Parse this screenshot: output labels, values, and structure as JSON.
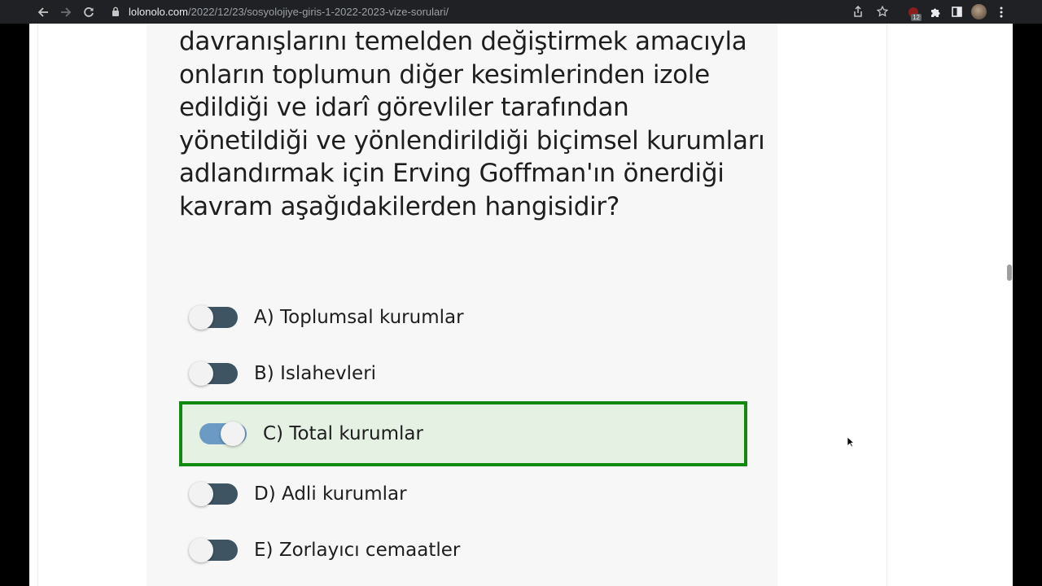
{
  "browser": {
    "url_host": "lolonolo.com",
    "url_path": "/2022/12/23/sosyolojiye-giris-1-2022-2023-vize-sorulari/",
    "extension_badge": "12",
    "icons": [
      "back-icon",
      "forward-icon",
      "reload-icon",
      "lock-icon",
      "share-icon",
      "bookmark-star-icon",
      "extension-icon",
      "puzzle-icon",
      "sidebar-icon",
      "avatar",
      "menu-icon"
    ]
  },
  "question": {
    "text": "davranışlarını temelden değiştirmek amacıyla onların toplumun diğer kesimlerinden izole edildiği ve idarî görevliler tarafından yönetildiği ve yönlendirildiği biçimsel kurumları adlandırmak için Erving Goffman'ın önerdiği kavram aşağıdakilerden hangisidir?"
  },
  "options": [
    {
      "label": "A) Toplumsal kurumlar",
      "selected": false
    },
    {
      "label": "B) Islahevleri",
      "selected": false
    },
    {
      "label": "C) Total kurumlar",
      "selected": true,
      "correct": true
    },
    {
      "label": "D) Adli kurumlar",
      "selected": false
    },
    {
      "label": "E) Zorlayıcı cemaatler",
      "selected": false
    }
  ],
  "colors": {
    "correct_border": "#0f8a0f",
    "correct_bg": "#e4f1e3",
    "toggle_off": "#3e5462",
    "toggle_on": "#6b9ac4"
  }
}
